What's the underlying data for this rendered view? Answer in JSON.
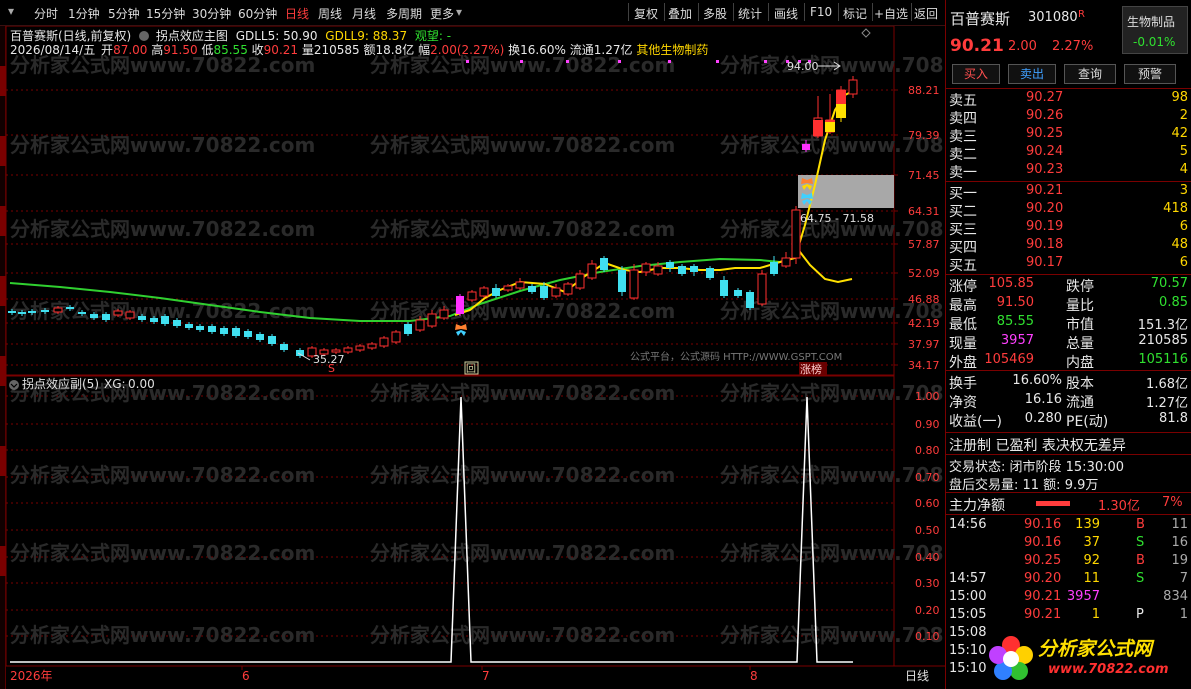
{
  "toolbar": {
    "periods": [
      "分时",
      "1分钟",
      "5分钟",
      "15分钟",
      "30分钟",
      "60分钟",
      "日线",
      "周线",
      "月线",
      "多周期",
      "更多"
    ],
    "active_period": "日线",
    "tools": [
      "复权",
      "叠加",
      "多股",
      "统计",
      "画线",
      "F10",
      "标记",
      "+自选",
      "返回"
    ]
  },
  "main_chart": {
    "title": "百普赛斯(日线,前复权)",
    "indicator_name": "拐点效应主图",
    "gdll5_label": "GDLL5:",
    "gdll5_value": "50.90",
    "gdll9_label": "GDLL9:",
    "gdll9_value": "88.37",
    "watch_label": "观望:",
    "watch_value": "-",
    "date": "2026/08/14/五",
    "open_label": "开",
    "open_value": "87.00",
    "high_label": "高",
    "high_value": "91.50",
    "low_label": "低",
    "low_value": "85.55",
    "close_label": "收",
    "close_value": "90.21",
    "volume_label": "量",
    "volume_value": "210585",
    "amount_label": "额",
    "amount_value": "18.8亿",
    "change_label": "幅",
    "change_value": "2.00(2.27%)",
    "turnover_label": "换",
    "turnover_value": "16.60%",
    "float_label": "流通",
    "float_value": "1.27亿",
    "sector": "其他生物制药",
    "price_axis": [
      "88.21",
      "79.39",
      "71.45",
      "64.31",
      "57.87",
      "52.09",
      "46.88",
      "42.19",
      "37.97",
      "34.17"
    ],
    "annot_high": "94.00",
    "annot_low": "35.27",
    "annot_range": "64.75 - 71.58",
    "marker_s": "S",
    "marker_hui": "回",
    "marker_zhangbang": "涨榜",
    "watermark_site": "分析家公式网www.70822.com",
    "watermark_platform": "公式平台，公式源码 HTTP://WWW.GSPT.COM"
  },
  "sub_chart": {
    "title": "拐点效应副(5)",
    "xg_label": "XG:",
    "xg_value": "0.00",
    "axis": [
      "1.00",
      "0.90",
      "0.80",
      "0.70",
      "0.60",
      "0.50",
      "0.40",
      "0.30",
      "0.20",
      "0.10"
    ],
    "x_axis": [
      "2026年",
      "6",
      "7",
      "8"
    ],
    "period_label": "日线"
  },
  "quote": {
    "name": "百普赛斯",
    "code": "301080",
    "flag": "R",
    "sector": "生物制品",
    "price": "90.21",
    "change": "2.00",
    "change_pct": "2.27%",
    "sector_change": "-0.01%",
    "buttons": [
      "买入",
      "卖出",
      "查询",
      "预警"
    ],
    "asks": [
      {
        "label": "卖五",
        "price": "90.27",
        "vol": "98"
      },
      {
        "label": "卖四",
        "price": "90.26",
        "vol": "2"
      },
      {
        "label": "卖三",
        "price": "90.25",
        "vol": "42"
      },
      {
        "label": "卖二",
        "price": "90.24",
        "vol": "5"
      },
      {
        "label": "卖一",
        "price": "90.23",
        "vol": "4"
      }
    ],
    "bids": [
      {
        "label": "买一",
        "price": "90.21",
        "vol": "3"
      },
      {
        "label": "买二",
        "price": "90.20",
        "vol": "418"
      },
      {
        "label": "买三",
        "price": "90.19",
        "vol": "6"
      },
      {
        "label": "买四",
        "price": "90.18",
        "vol": "48"
      },
      {
        "label": "买五",
        "price": "90.17",
        "vol": "6"
      }
    ],
    "stats": [
      {
        "l1": "涨停",
        "v1": "105.85",
        "l2": "跌停",
        "v2": "70.57"
      },
      {
        "l1": "最高",
        "v1": "91.50",
        "l2": "量比",
        "v2": "0.85"
      },
      {
        "l1": "最低",
        "v1": "85.55",
        "l2": "市值",
        "v2": "151.3亿"
      },
      {
        "l1": "现量",
        "v1": "3957",
        "l2": "总量",
        "v2": "210585"
      },
      {
        "l1": "外盘",
        "v1": "105469",
        "l2": "内盘",
        "v2": "105116"
      }
    ],
    "stats2": [
      {
        "l1": "换手",
        "v1": "16.60%",
        "l2": "股本",
        "v2": "1.68亿"
      },
      {
        "l1": "净资",
        "v1": "16.16",
        "l2": "流通",
        "v2": "1.27亿"
      },
      {
        "l1": "收益(一)",
        "v1": "0.280",
        "l2": "PE(动)",
        "v2": "81.8"
      }
    ],
    "registration": "注册制 已盈利 表决权无差异",
    "trade_status": "交易状态: 闭市阶段 15:30:00",
    "after_hours": "盘后交易量: 11  额: 9.9万",
    "main_flow_label": "主力净额",
    "main_flow_value": "1.30亿",
    "main_flow_pct": "7%",
    "ticks": [
      {
        "time": "14:56",
        "price": "90.16",
        "vol": "139",
        "side": "B",
        "n": "11"
      },
      {
        "time": "",
        "price": "90.16",
        "vol": "37",
        "side": "S",
        "n": "16"
      },
      {
        "time": "",
        "price": "90.25",
        "vol": "92",
        "side": "B",
        "n": "19"
      },
      {
        "time": "14:57",
        "price": "90.20",
        "vol": "11",
        "side": "S",
        "n": "7"
      },
      {
        "time": "15:00",
        "price": "90.21",
        "vol": "3957",
        "side": "",
        "n": "834"
      },
      {
        "time": "15:05",
        "price": "90.21",
        "vol": "1",
        "side": "P",
        "n": "1"
      },
      {
        "time": "15:08",
        "price": "",
        "vol": "",
        "side": "",
        "n": ""
      },
      {
        "time": "15:10",
        "price": "",
        "vol": "",
        "side": "",
        "n": ""
      },
      {
        "time": "15:10",
        "price": "",
        "vol": "",
        "side": "",
        "n": ""
      }
    ],
    "logo_text": "分析家公式网",
    "logo_url": "www.70822.com"
  },
  "chart_data": {
    "type": "candlestick",
    "price_axis": [
      88.21,
      79.39,
      71.45,
      64.31,
      57.87,
      52.09,
      46.88,
      42.19,
      37.97,
      34.17
    ],
    "sub_series": {
      "name": "XG",
      "values": [
        0,
        1,
        0,
        1,
        0
      ]
    }
  }
}
